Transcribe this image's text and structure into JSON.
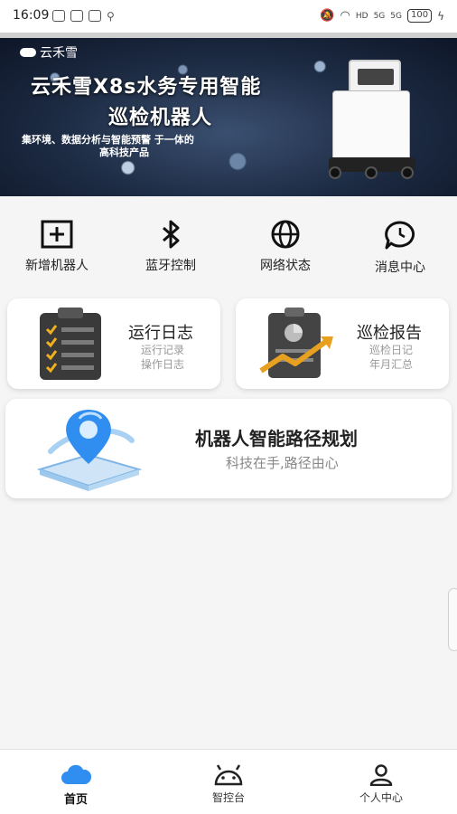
{
  "status_bar": {
    "time": "16:09",
    "network_labels": [
      "HD",
      "5G",
      "5G"
    ],
    "battery": "100"
  },
  "banner": {
    "logo": "云禾雪",
    "title_line1": "云禾雪X8s水务专用智能",
    "title_line2": "巡检机器人",
    "subtitle_line1": "集环境、数据分析与智能预警 于一体的",
    "subtitle_line2": "高科技产品",
    "slides": 4,
    "active_slide": 1
  },
  "quick_actions": [
    {
      "label": "新增机器人",
      "icon": "add-square-icon"
    },
    {
      "label": "蓝牙控制",
      "icon": "bluetooth-icon"
    },
    {
      "label": "网络状态",
      "icon": "globe-icon"
    },
    {
      "label": "消息中心",
      "icon": "message-clock-icon"
    }
  ],
  "cards": {
    "log": {
      "title": "运行日志",
      "sub1": "运行记录",
      "sub2": "操作日志",
      "icon": "clipboard-checklist-icon"
    },
    "report": {
      "title": "巡检报告",
      "sub1": "巡检日记",
      "sub2": "年月汇总",
      "icon": "report-chart-icon"
    },
    "route": {
      "title": "机器人智能路径规划",
      "sub": "科技在手,路径由心",
      "icon": "route-pin-icon"
    }
  },
  "bottom_nav": [
    {
      "label": "首页",
      "icon": "cloud-icon",
      "active": true
    },
    {
      "label": "智控台",
      "icon": "android-icon",
      "active": false
    },
    {
      "label": "个人中心",
      "icon": "person-icon",
      "active": false
    }
  ],
  "colors": {
    "accent": "#2f8ef0",
    "card_bg": "#ffffff",
    "page_bg": "#f5f5f5"
  }
}
